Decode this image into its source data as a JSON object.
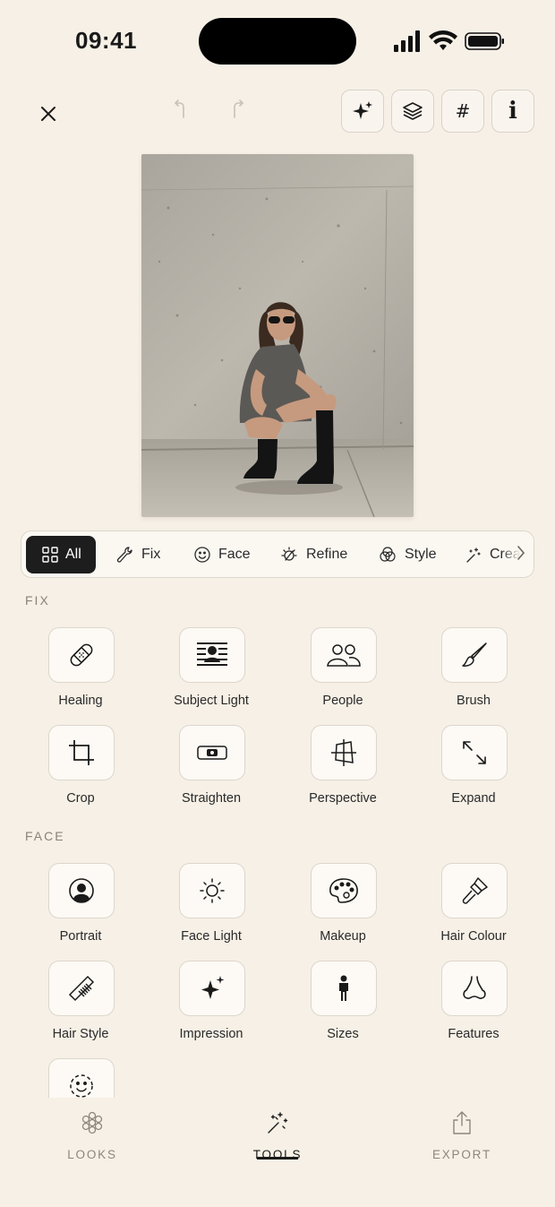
{
  "status": {
    "time": "09:41"
  },
  "topbar": {
    "close_icon": "close-icon",
    "undo_icon": "undo-icon",
    "redo_icon": "redo-icon",
    "actions": [
      "sparkle-icon",
      "layers-icon",
      "grid-hash-icon",
      "info-icon"
    ],
    "grid_glyph": "#",
    "info_glyph": "i"
  },
  "filters": [
    {
      "label": "All",
      "icon": "grid-icon",
      "active": true
    },
    {
      "label": "Fix",
      "icon": "wrench-icon"
    },
    {
      "label": "Face",
      "icon": "smile-icon"
    },
    {
      "label": "Refine",
      "icon": "sun-icon"
    },
    {
      "label": "Style",
      "icon": "circles-icon"
    },
    {
      "label": "Create",
      "icon": "magic-wand-icon"
    }
  ],
  "sections": {
    "fix": {
      "title": "FIX",
      "tools": [
        "Healing",
        "Subject Light",
        "People",
        "Brush",
        "Crop",
        "Straighten",
        "Perspective",
        "Expand"
      ]
    },
    "face": {
      "title": "FACE",
      "tools": [
        "Portrait",
        "Face Light",
        "Makeup",
        "Hair Colour",
        "Hair Style",
        "Impression",
        "Sizes",
        "Features"
      ]
    }
  },
  "tabs": [
    {
      "label": "LOOKS",
      "icon": "flower-icon"
    },
    {
      "label": "TOOLS",
      "icon": "magic-wand-icon",
      "active": true
    },
    {
      "label": "EXPORT",
      "icon": "share-icon"
    }
  ],
  "colors": {
    "background": "#f6f0e6",
    "accent": "#1d1d1d",
    "muted": "#8a8278"
  }
}
